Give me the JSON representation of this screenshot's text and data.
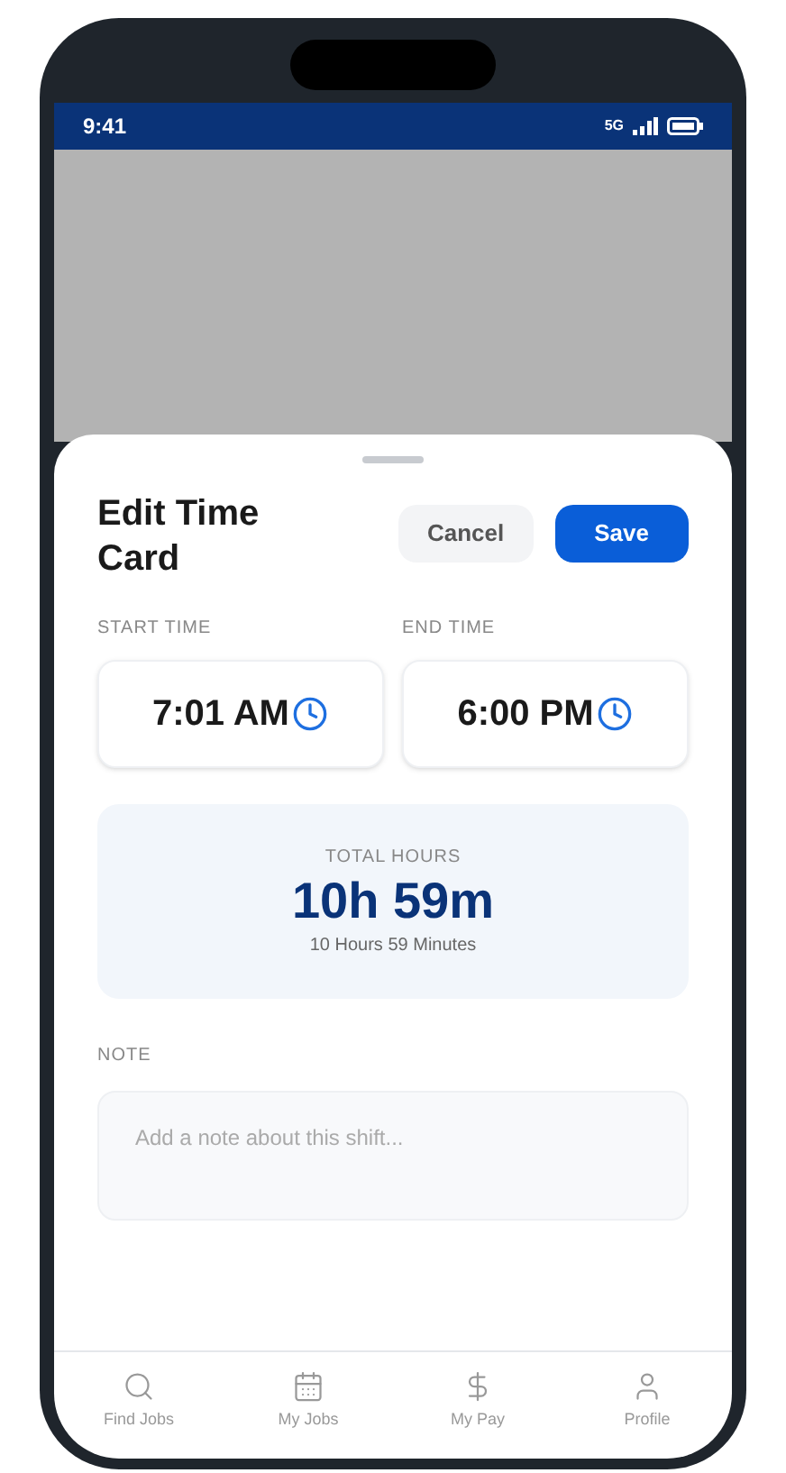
{
  "status_bar": {
    "time": "9:41",
    "network": "5G"
  },
  "sheet": {
    "title": "Edit Time Card",
    "cancel": "Cancel",
    "save": "Save",
    "times": [
      {
        "label": "START TIME",
        "value": "7:01 AM"
      },
      {
        "label": "END TIME",
        "value": "6:00 PM"
      }
    ],
    "total": {
      "label": "TOTAL HOURS",
      "value": "10h 59m",
      "detail": "10 Hours 59 Minutes"
    },
    "note": {
      "label": "NOTE",
      "placeholder": "Add a note about this shift..."
    }
  },
  "tab_bar": [
    {
      "label": "Find Jobs"
    },
    {
      "label": "My Jobs"
    },
    {
      "label": "My Pay"
    },
    {
      "label": "Profile"
    }
  ]
}
